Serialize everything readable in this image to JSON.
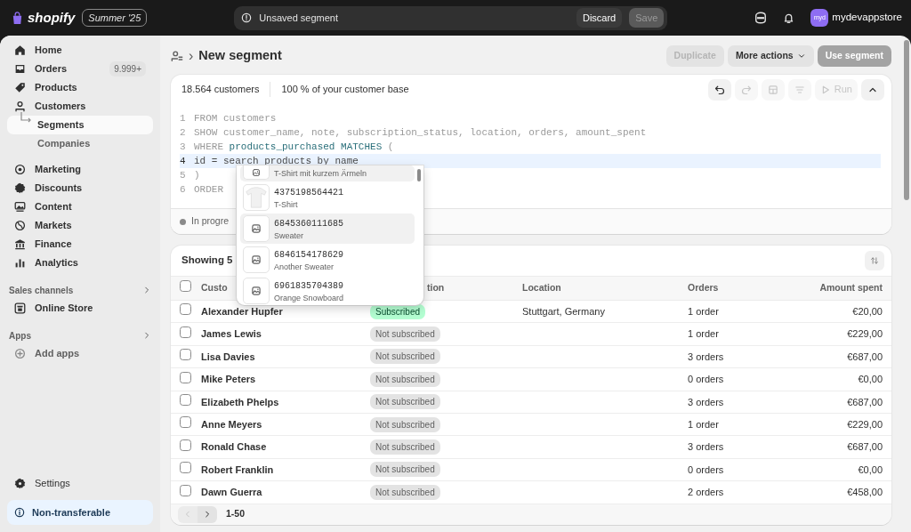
{
  "topbar": {
    "brand": "shopify",
    "edition": "Summer '25",
    "notice": "Unsaved segment",
    "discard": {
      "label": "Discard",
      "disabled": false
    },
    "save": {
      "label": "Save",
      "disabled": true
    },
    "avatar": "myd",
    "store": "mydevappstore"
  },
  "sidebar": {
    "nav": [
      {
        "label": "Home",
        "selected": false
      },
      {
        "label": "Orders",
        "badge": "9.999+",
        "selected": false
      },
      {
        "label": "Products",
        "selected": false
      },
      {
        "label": "Customers",
        "selected": false,
        "children": [
          {
            "label": "Segments",
            "selected": true
          },
          {
            "label": "Companies",
            "selected": false
          }
        ]
      }
    ],
    "nav2": [
      {
        "label": "Marketing",
        "selected": false
      },
      {
        "label": "Discounts",
        "selected": false
      },
      {
        "label": "Content",
        "selected": false
      },
      {
        "label": "Markets",
        "selected": false
      },
      {
        "label": "Finance",
        "selected": false
      },
      {
        "label": "Analytics",
        "selected": false
      }
    ],
    "sections": [
      {
        "title": "Sales channels",
        "items": [
          {
            "label": "Online Store",
            "kind": "store"
          }
        ]
      },
      {
        "title": "Apps",
        "items": [
          {
            "label": "Add apps",
            "kind": "add"
          }
        ]
      }
    ],
    "settings": "Settings",
    "notice": "Non-transferable"
  },
  "page": {
    "separator": "›",
    "title": "New segment",
    "actions": [
      {
        "label": "Duplicate",
        "disabled": true,
        "dropdown": false
      },
      {
        "label": "More actions",
        "disabled": false,
        "dropdown": true
      },
      {
        "label": "Use segment",
        "disabled": true,
        "dropdown": false
      }
    ]
  },
  "editor": {
    "count": "18.564 customers",
    "share": "100 % of your customer base",
    "toolbar": [
      {
        "kind": "undo",
        "disabled": false
      },
      {
        "kind": "redo",
        "disabled": true
      },
      {
        "kind": "layout",
        "disabled": true
      },
      {
        "kind": "format",
        "disabled": true
      },
      {
        "kind": "run",
        "label": "Run",
        "disabled": true
      },
      {
        "kind": "collapse",
        "disabled": false
      }
    ],
    "lines": [
      {
        "number": "1",
        "current": false,
        "tokens": [
          {
            "text": "FROM customers",
            "kind": "muted"
          }
        ]
      },
      {
        "number": "2",
        "current": false,
        "tokens": [
          {
            "text": "SHOW customer_name, note, subscription_status, location, orders, amount_spent",
            "kind": "muted"
          }
        ]
      },
      {
        "number": "3",
        "current": false,
        "tokens": [
          {
            "text": "WHERE ",
            "kind": "muted"
          },
          {
            "text": "products_purchased MATCHES",
            "kind": "accent"
          },
          {
            "text": " (",
            "kind": "muted"
          }
        ]
      },
      {
        "number": "4",
        "current": true,
        "tokens": [
          {
            "text": "id = search products by name",
            "kind": "plain"
          }
        ]
      },
      {
        "number": "5",
        "current": false,
        "tokens": [
          {
            "text": ")",
            "kind": "muted"
          }
        ]
      },
      {
        "number": "6",
        "current": false,
        "tokens": [
          {
            "text": "ORDER",
            "kind": "muted"
          }
        ]
      }
    ],
    "status": "In progre",
    "suggestions": [
      {
        "name": "T-Shirt mit kurzem Ärmeln",
        "kind": "placeholder",
        "highlighted": true
      },
      {
        "id": "4375198564421",
        "name": "T-Shirt",
        "kind": "photo",
        "highlighted": false
      },
      {
        "id": "6845360111685",
        "name": "Sweater",
        "kind": "placeholder",
        "highlighted": true
      },
      {
        "id": "6846154178629",
        "name": "Another Sweater",
        "kind": "placeholder",
        "highlighted": false
      },
      {
        "id": "6961835704389",
        "name": "Orange Snowboard",
        "kind": "placeholder",
        "highlighted": false
      }
    ]
  },
  "table": {
    "title": "Showing 5",
    "select_all": {
      "checked": false
    },
    "columns": [
      "Custo",
      "tion",
      "Location",
      "Orders",
      "Amount spent"
    ],
    "rows": [
      {
        "checked": false,
        "name": "Alexander Hupfer",
        "subscription": "Subscribed",
        "subscribed": true,
        "location": "Stuttgart, Germany",
        "orders": "1 order",
        "amount": "€20,00"
      },
      {
        "checked": false,
        "name": "James Lewis",
        "subscription": "Not subscribed",
        "subscribed": false,
        "orders": "1 order",
        "amount": "€229,00"
      },
      {
        "checked": false,
        "name": "Lisa Davies",
        "subscription": "Not subscribed",
        "subscribed": false,
        "orders": "3 orders",
        "amount": "€687,00"
      },
      {
        "checked": false,
        "name": "Mike Peters",
        "subscription": "Not subscribed",
        "subscribed": false,
        "orders": "0 orders",
        "amount": "€0,00"
      },
      {
        "checked": false,
        "name": "Elizabeth Phelps",
        "subscription": "Not subscribed",
        "subscribed": false,
        "orders": "3 orders",
        "amount": "€687,00"
      },
      {
        "checked": false,
        "name": "Anne Meyers",
        "subscription": "Not subscribed",
        "subscribed": false,
        "orders": "1 order",
        "amount": "€229,00"
      },
      {
        "checked": false,
        "name": "Ronald Chase",
        "subscription": "Not subscribed",
        "subscribed": false,
        "orders": "3 orders",
        "amount": "€687,00"
      },
      {
        "checked": false,
        "name": "Robert Franklin",
        "subscription": "Not subscribed",
        "subscribed": false,
        "orders": "0 orders",
        "amount": "€0,00"
      },
      {
        "checked": false,
        "name": "Dawn Guerra",
        "subscription": "Not subscribed",
        "subscribed": false,
        "orders": "2 orders",
        "amount": "€458,00"
      }
    ],
    "pagination": {
      "prev_disabled": true,
      "next_disabled": false,
      "range": "1-50"
    }
  }
}
